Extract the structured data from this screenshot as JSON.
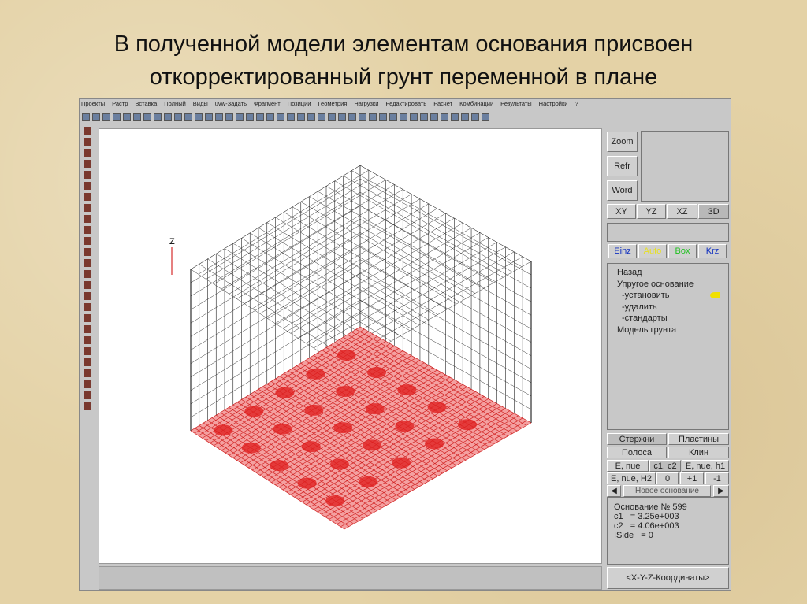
{
  "slide": {
    "title_line1": "В полученной модели элементам основания присвоен",
    "title_line2": "откорректированный грунт переменной в плане"
  },
  "menu": [
    "Проекты",
    "Растр",
    "Вставка",
    "Полный",
    "Виды",
    "uvw-Задать",
    "Фрагмент",
    "Позиции",
    "Геометрия",
    "Нагрузки",
    "Редактировать",
    "Расчет",
    "Комбинации",
    "Результаты",
    "Настройки",
    "?"
  ],
  "right_panel": {
    "zoom": "Zoom",
    "refr": "Refr",
    "word": "Word",
    "views": [
      "XY",
      "YZ",
      "XZ",
      "3D"
    ],
    "modes": [
      {
        "label": "Einz",
        "color": "#1030c0"
      },
      {
        "label": "Auto",
        "color": "#e8e020"
      },
      {
        "label": "Box",
        "color": "#20c020"
      },
      {
        "label": "Krz",
        "color": "#1030c0"
      }
    ],
    "menu_items": [
      "Назад",
      "Упругое основание",
      "-установить",
      "-удалить",
      "-стандарты",
      "Модель грунта"
    ],
    "buttons": {
      "sterzhni": "Стержни",
      "plastiny": "Пластины",
      "polosa": "Полоса",
      "klin": "Клин",
      "e_nue": "E, nue",
      "c1c2": "c1, c2",
      "e_nue_h1": "E, nue, h1",
      "e_nue_h2": "E, nue, H2",
      "zero": "0",
      "plus1": "+1",
      "minus1": "-1",
      "new_base": "Новое основание"
    },
    "info": [
      "Основание № 599",
      "c1   = 3.25e+003",
      "c2   = 4.06e+003",
      "ISide   = 0"
    ],
    "coords": "<X-Y-Z-Координаты>"
  },
  "axis": {
    "z": "Z"
  }
}
